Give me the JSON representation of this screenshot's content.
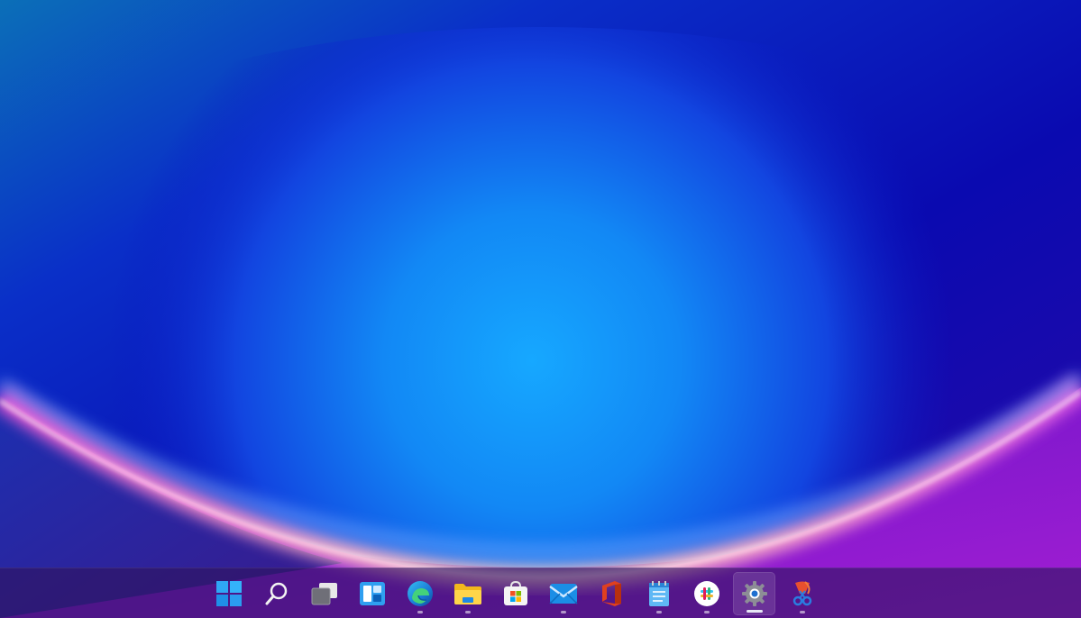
{
  "desktop": {
    "wallpaper": "windows-11-bloom",
    "colors": {
      "deep_blue": "#0a0aa0",
      "mid_blue": "#1a5ef0",
      "glow_blue": "#19a7ff",
      "pink_rim": "#ff6ad8",
      "peach_rim": "#ffc0b8",
      "purple_corner": "#8a1ec8"
    }
  },
  "taskbar": {
    "background": "#2e1460",
    "items": [
      {
        "name": "start",
        "icon": "windows-logo-icon",
        "running": false,
        "active": false
      },
      {
        "name": "search",
        "icon": "search-icon",
        "running": false,
        "active": false
      },
      {
        "name": "task-view",
        "icon": "task-view-icon",
        "running": false,
        "active": false
      },
      {
        "name": "widgets",
        "icon": "widgets-icon",
        "running": false,
        "active": false
      },
      {
        "name": "edge",
        "icon": "edge-icon",
        "running": true,
        "active": false
      },
      {
        "name": "file-explorer",
        "icon": "folder-icon",
        "running": true,
        "active": false
      },
      {
        "name": "microsoft-store",
        "icon": "store-icon",
        "running": false,
        "active": false
      },
      {
        "name": "mail",
        "icon": "mail-icon",
        "running": true,
        "active": false
      },
      {
        "name": "office",
        "icon": "office-icon",
        "running": false,
        "active": false
      },
      {
        "name": "notepad",
        "icon": "notepad-icon",
        "running": true,
        "active": false
      },
      {
        "name": "slack",
        "icon": "slack-icon",
        "running": true,
        "active": false
      },
      {
        "name": "settings",
        "icon": "gear-icon",
        "running": true,
        "active": true
      },
      {
        "name": "snipping-tool",
        "icon": "snipping-tool-icon",
        "running": true,
        "active": false
      }
    ]
  }
}
